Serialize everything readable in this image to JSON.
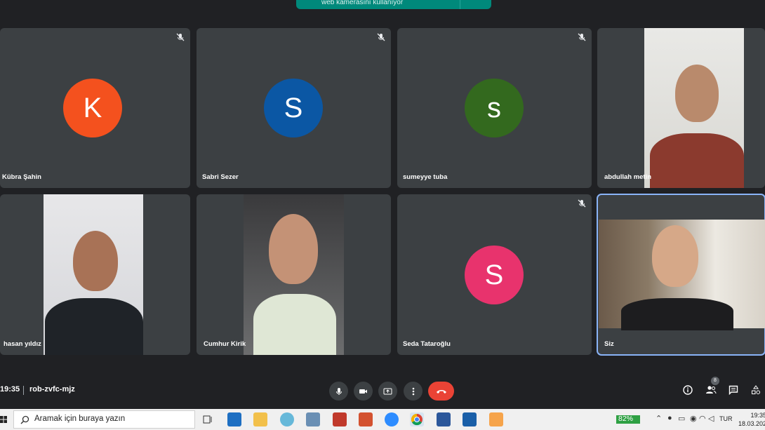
{
  "banner": {
    "text": "web kamerasını kullanıyor"
  },
  "participants": [
    {
      "name": "Kübra Şahin",
      "initial": "K",
      "color": "#f4511e",
      "muted": true,
      "video": false
    },
    {
      "name": "Sabri Sezer",
      "initial": "S",
      "color": "#0b57a4",
      "muted": true,
      "video": false
    },
    {
      "name": "sumeyye tuba",
      "initial": "s",
      "color": "#33691e",
      "muted": true,
      "video": false
    },
    {
      "name": "abdullah metin",
      "muted": false,
      "video": true
    },
    {
      "name": "hasan yıldız",
      "muted": false,
      "video": true
    },
    {
      "name": "Cumhur Kirik",
      "muted": false,
      "video": true
    },
    {
      "name": "Seda Tataroğlu",
      "initial": "S",
      "color": "#e8336d",
      "muted": true,
      "video": false
    },
    {
      "name": "Siz",
      "muted": false,
      "video": true,
      "active": true
    }
  ],
  "meeting": {
    "time": "19:35",
    "code": "rob-zvfc-mjz",
    "participant_count": "8"
  },
  "controls": {
    "mic_icon": "microphone-icon",
    "camera_icon": "camera-icon",
    "present_icon": "present-screen-icon",
    "more_icon": "more-vert-icon",
    "end_icon": "end-call-icon",
    "end_color": "#ea4335"
  },
  "right_icons": [
    "info-icon",
    "people-icon",
    "chat-icon",
    "activities-icon"
  ],
  "taskbar": {
    "search_placeholder": "Aramak için buraya yazın",
    "battery": "82%",
    "language": "TUR",
    "time": "19:35",
    "date": "18.03.202"
  },
  "colors": {
    "background": "#202124",
    "tile": "#3c4043",
    "active_border": "#8ab4f8",
    "battery": "#2ea043"
  }
}
